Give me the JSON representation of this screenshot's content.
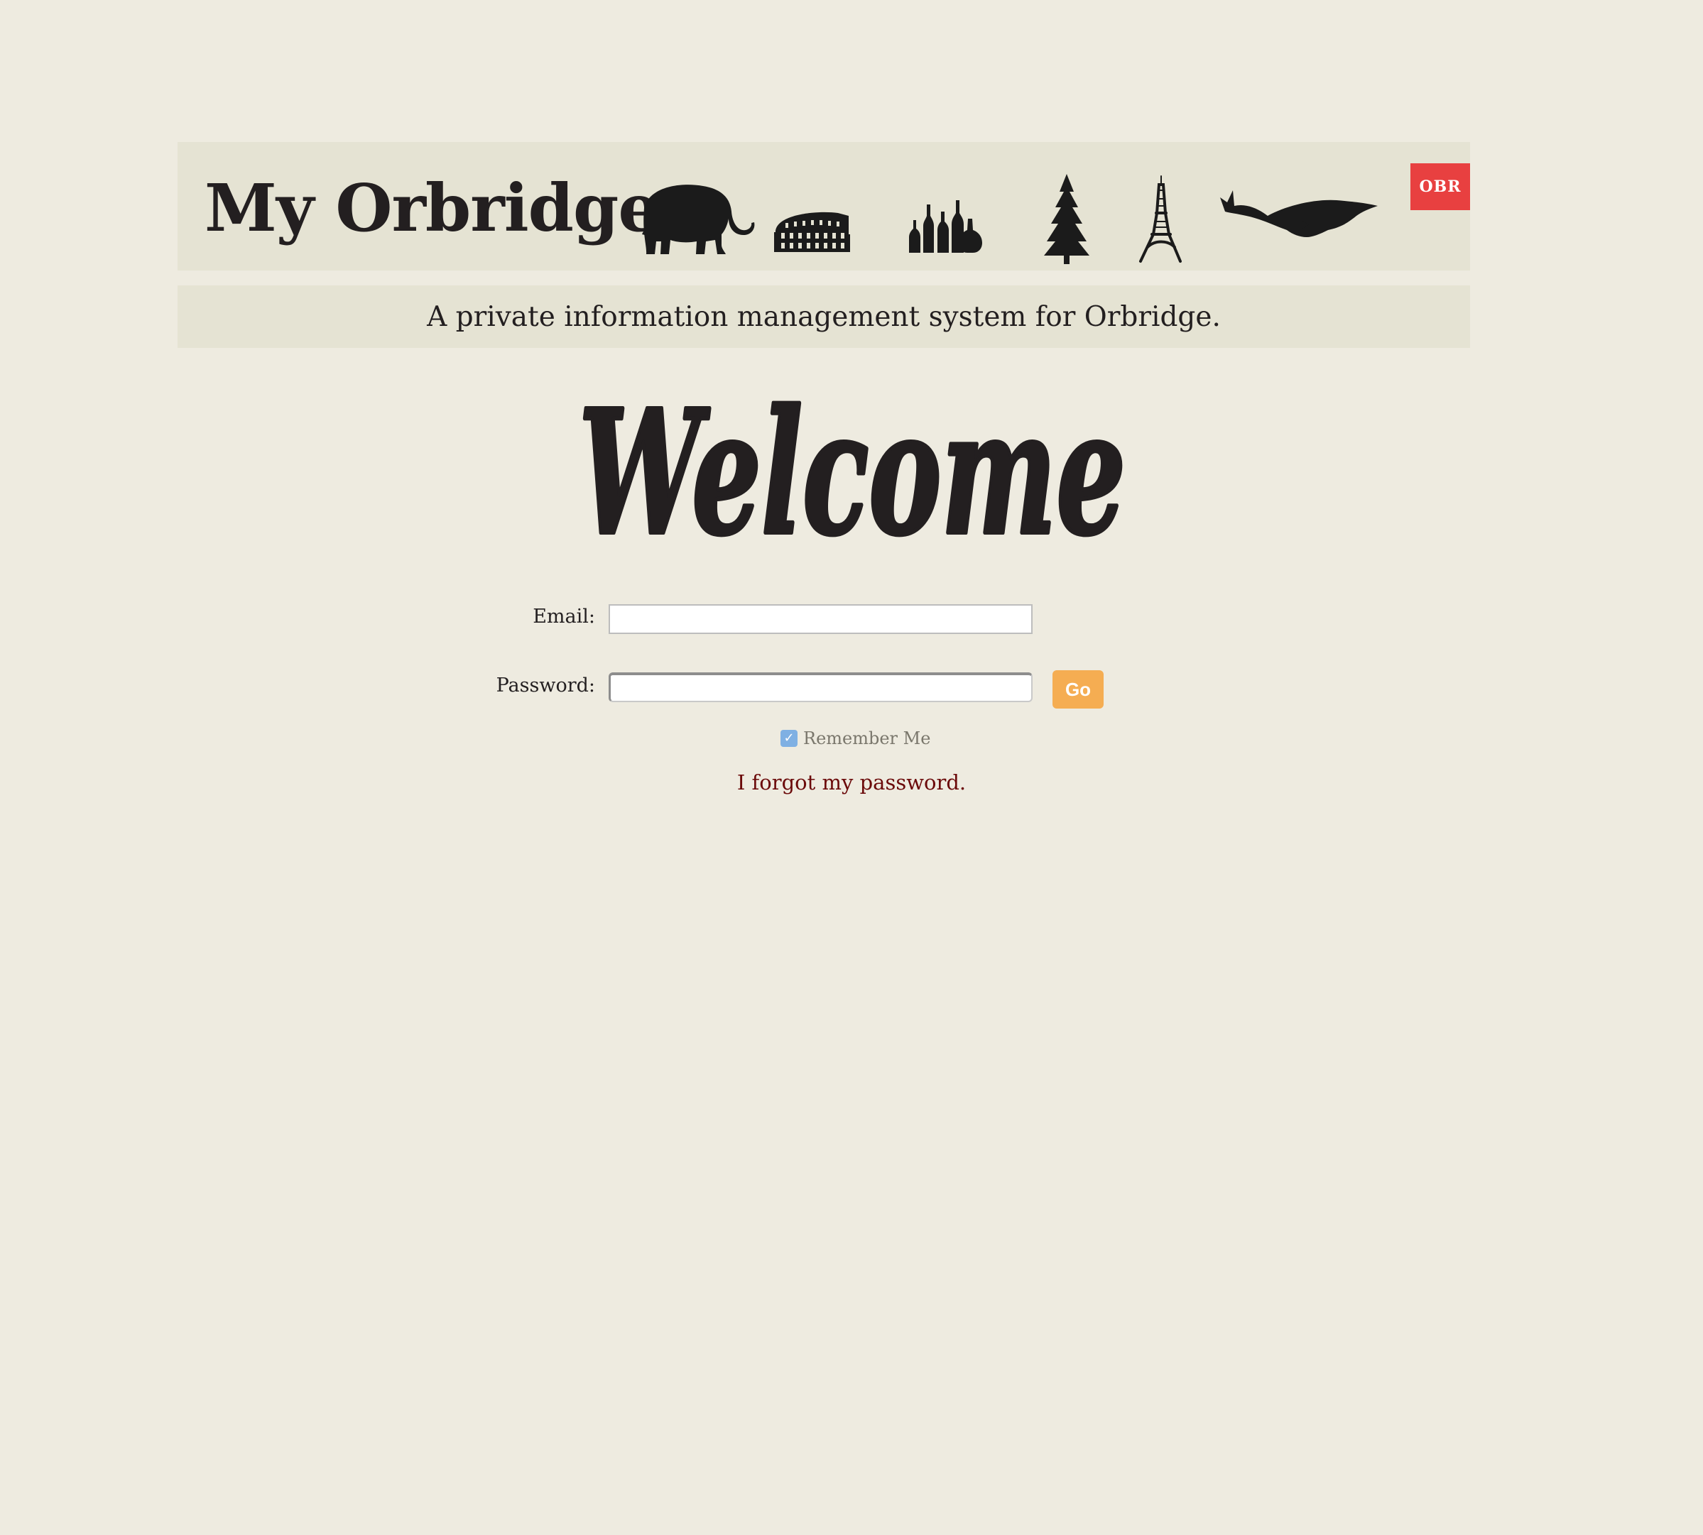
{
  "header": {
    "title": "My Orbridge",
    "badge": "OBR",
    "icons": [
      "elephant-icon",
      "colosseum-icon",
      "wine-bottles-icon",
      "pine-tree-icon",
      "eiffel-tower-icon",
      "whale-icon"
    ],
    "badge_color": "#e84040"
  },
  "tagline": "A private information management system for Orbridge.",
  "welcome": {
    "heading": "Welcome"
  },
  "login_form": {
    "email_label": "Email:",
    "email_value": "",
    "password_label": "Password:",
    "password_value": "",
    "submit_label": "Go",
    "remember_label": "Remember Me",
    "remember_checked": true,
    "forgot_link": "I forgot my password."
  },
  "colors": {
    "background": "#eeebe0",
    "banner": "#e5e3d3",
    "accent": "#f5ad52",
    "link": "#6b0a0a",
    "checkbox": "#7fb0e3"
  }
}
